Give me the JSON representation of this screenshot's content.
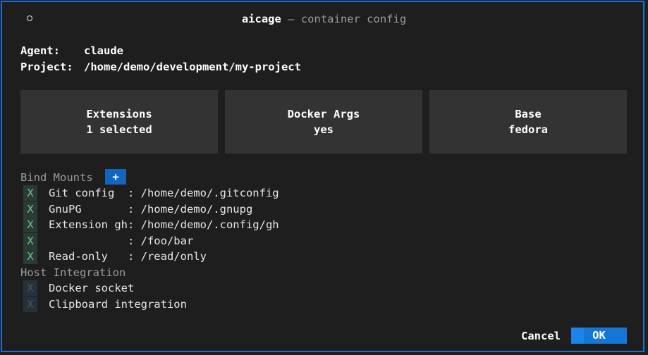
{
  "title": {
    "app": "aicage",
    "separator": " — ",
    "subtitle": "container config"
  },
  "info": {
    "agent_label": "Agent:",
    "agent_value": "claude",
    "project_label": "Project:",
    "project_value": "/home/demo/development/my-project"
  },
  "cards": [
    {
      "title": "Extensions",
      "value": "1 selected"
    },
    {
      "title": "Docker Args",
      "value": "yes"
    },
    {
      "title": "Base",
      "value": "fedora"
    }
  ],
  "bind_mounts": {
    "heading": "Bind Mounts",
    "add_label": "+",
    "items": [
      {
        "mark": "X",
        "name": "Git config  ",
        "path": ": /home/demo/.gitconfig"
      },
      {
        "mark": "X",
        "name": "GnuPG       ",
        "path": ": /home/demo/.gnupg"
      },
      {
        "mark": "X",
        "name": "Extension gh",
        "path": ": /home/demo/.config/gh"
      },
      {
        "mark": "X",
        "name": "            ",
        "path": ": /foo/bar"
      },
      {
        "mark": "X",
        "name": "Read-only   ",
        "path": ": /read/only"
      }
    ]
  },
  "host_integration": {
    "heading": "Host Integration",
    "items": [
      {
        "mark": "X",
        "label": "Docker socket",
        "enabled": false
      },
      {
        "mark": "X",
        "label": "Clipboard integration",
        "enabled": false
      }
    ]
  },
  "buttons": {
    "cancel": "Cancel",
    "ok": "OK"
  },
  "colors": {
    "accent": "#1f6fd0",
    "checked": "#6fc48a",
    "background": "#1e1e1e"
  }
}
